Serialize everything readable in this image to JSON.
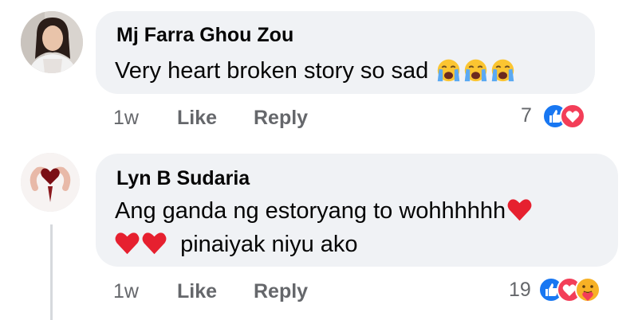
{
  "comments": [
    {
      "author": "Mj Farra Ghou Zou",
      "text": "Very heart broken story so sad",
      "text_emojis": [
        "crying-face",
        "crying-face",
        "crying-face"
      ],
      "time": "1w",
      "like_label": "Like",
      "reply_label": "Reply",
      "reaction_count": "7",
      "reactions": [
        "like",
        "love"
      ]
    },
    {
      "author": "Lyn B Sudaria",
      "text_line1": "Ang ganda ng estoryang to wohhhhhh",
      "text_line2": "pinaiyak niyu ako",
      "text_emojis": [
        "red-heart",
        "red-heart",
        "red-heart"
      ],
      "time": "1w",
      "like_label": "Like",
      "reply_label": "Reply",
      "reaction_count": "19",
      "reactions": [
        "like",
        "love",
        "care"
      ]
    }
  ],
  "colors": {
    "bubble": "#f0f2f5",
    "meta_text": "#65676b",
    "like_blue": "#1877f2",
    "love_red": "#f33e58",
    "care_yellow": "#f7b125"
  }
}
